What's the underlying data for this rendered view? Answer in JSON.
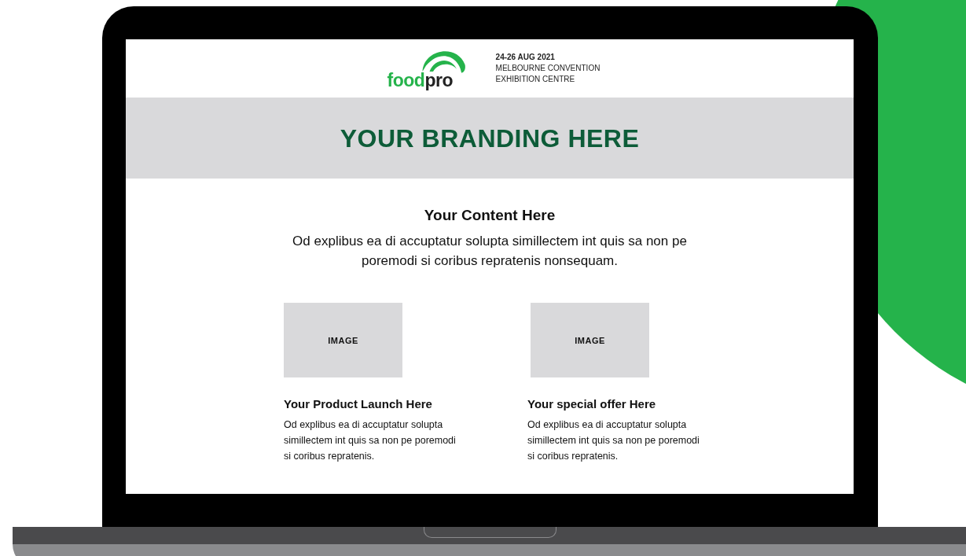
{
  "header": {
    "logo": {
      "primary": "food",
      "secondary": "pro"
    },
    "event": {
      "dates": "24-26 AUG 2021",
      "venue_lines": [
        "MELBOURNE CONVENTION",
        "EXHIBITION CENTRE"
      ]
    }
  },
  "banner": {
    "title": "YOUR BRANDING HERE"
  },
  "intro": {
    "title": "Your Content Here",
    "text": "Od explibus ea di accuptatur solupta simillectem int quis sa non pe poremodi si coribus repratenis nonsequam."
  },
  "features": [
    {
      "image_label": "IMAGE",
      "title": "Your Product Launch Here",
      "text": "Od explibus ea di accuptatur solupta simillectem int quis sa non pe poremodi si coribus repratenis."
    },
    {
      "image_label": "IMAGE",
      "title": "Your special offer Here",
      "text": "Od explibus ea di accuptatur solupta simillectem int quis sa non pe poremodi si coribus repratenis."
    }
  ]
}
